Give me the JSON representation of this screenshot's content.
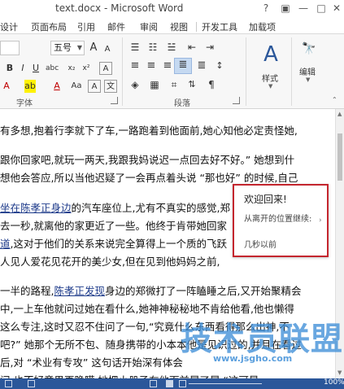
{
  "window": {
    "title": "text.docx - Microsoft Word",
    "help": "?",
    "restore": "▣",
    "minimize": "—",
    "maximize": "□",
    "close": "✕"
  },
  "tabs": [
    "设计",
    "页面布局",
    "引用",
    "邮件",
    "审阅",
    "视图",
    "开发工具",
    "加载项"
  ],
  "ribbon": {
    "font_size_value": "五号",
    "grow_font": "A",
    "shrink_font": "A",
    "font_settings": "Aa",
    "clear_format": "A",
    "wen_button": "文",
    "font_group_label": "字体",
    "para_group_label": "段落",
    "style_label": "样式",
    "edit_label": "编辑",
    "find_icon": "🔭"
  },
  "document": {
    "lines": [
      "有多想,抱着行李就下了车,一路跑着到他面前,她心知他必定责怪她,",
      "",
      "跟你回家吧,就玩一两天,我跟我妈说迟一点回去好不好。” 她想到什",
      "想他会答应,所以当他迟疑了一会再点着头说 “那也好” 的时候,自己",
      "",
      "坐在陈孝正身边的汽车座位上,尤有不真实的感觉,郑",
      "去一秒,就离他的家更近了一些。他终于肯带她回家",
      "道,这对于他们的关系来说完全算得上一个质的飞跃",
      "人见人爱花见花开的美少女,但在见到他妈妈之前,",
      "",
      "一半的路程,陈孝正发现身边的郑微打了一阵瞌睡之后,又开始聚精会",
      "中,一上车他就问过她在看什么,她神神秘秘地不肯给他看,他也懒得",
      "这么专注,这时又忍不住问了一句,“究竟什么东西看得那么出神,不",
      "吧?” 她那个无所不包、随身携带的小本本他是见识过的,并且在看过",
      "后,对 “术业有专攻” 这句话开始深有体会",
      "问,也不好意思再隐瞒,她把小册子在他面前晃了晃,“这可是"
    ],
    "link_1": "坐在陈孝正身边",
    "link_2": "道",
    "link_3": "陈孝正发现"
  },
  "popup": {
    "title": "欢迎回来!",
    "subtitle": "从离开的位置继续:",
    "time": "几秒以前"
  },
  "statusbar": {
    "zoom": "100%"
  },
  "watermark": {
    "main": "技术员联盟",
    "url": "www.jsgho.com"
  }
}
